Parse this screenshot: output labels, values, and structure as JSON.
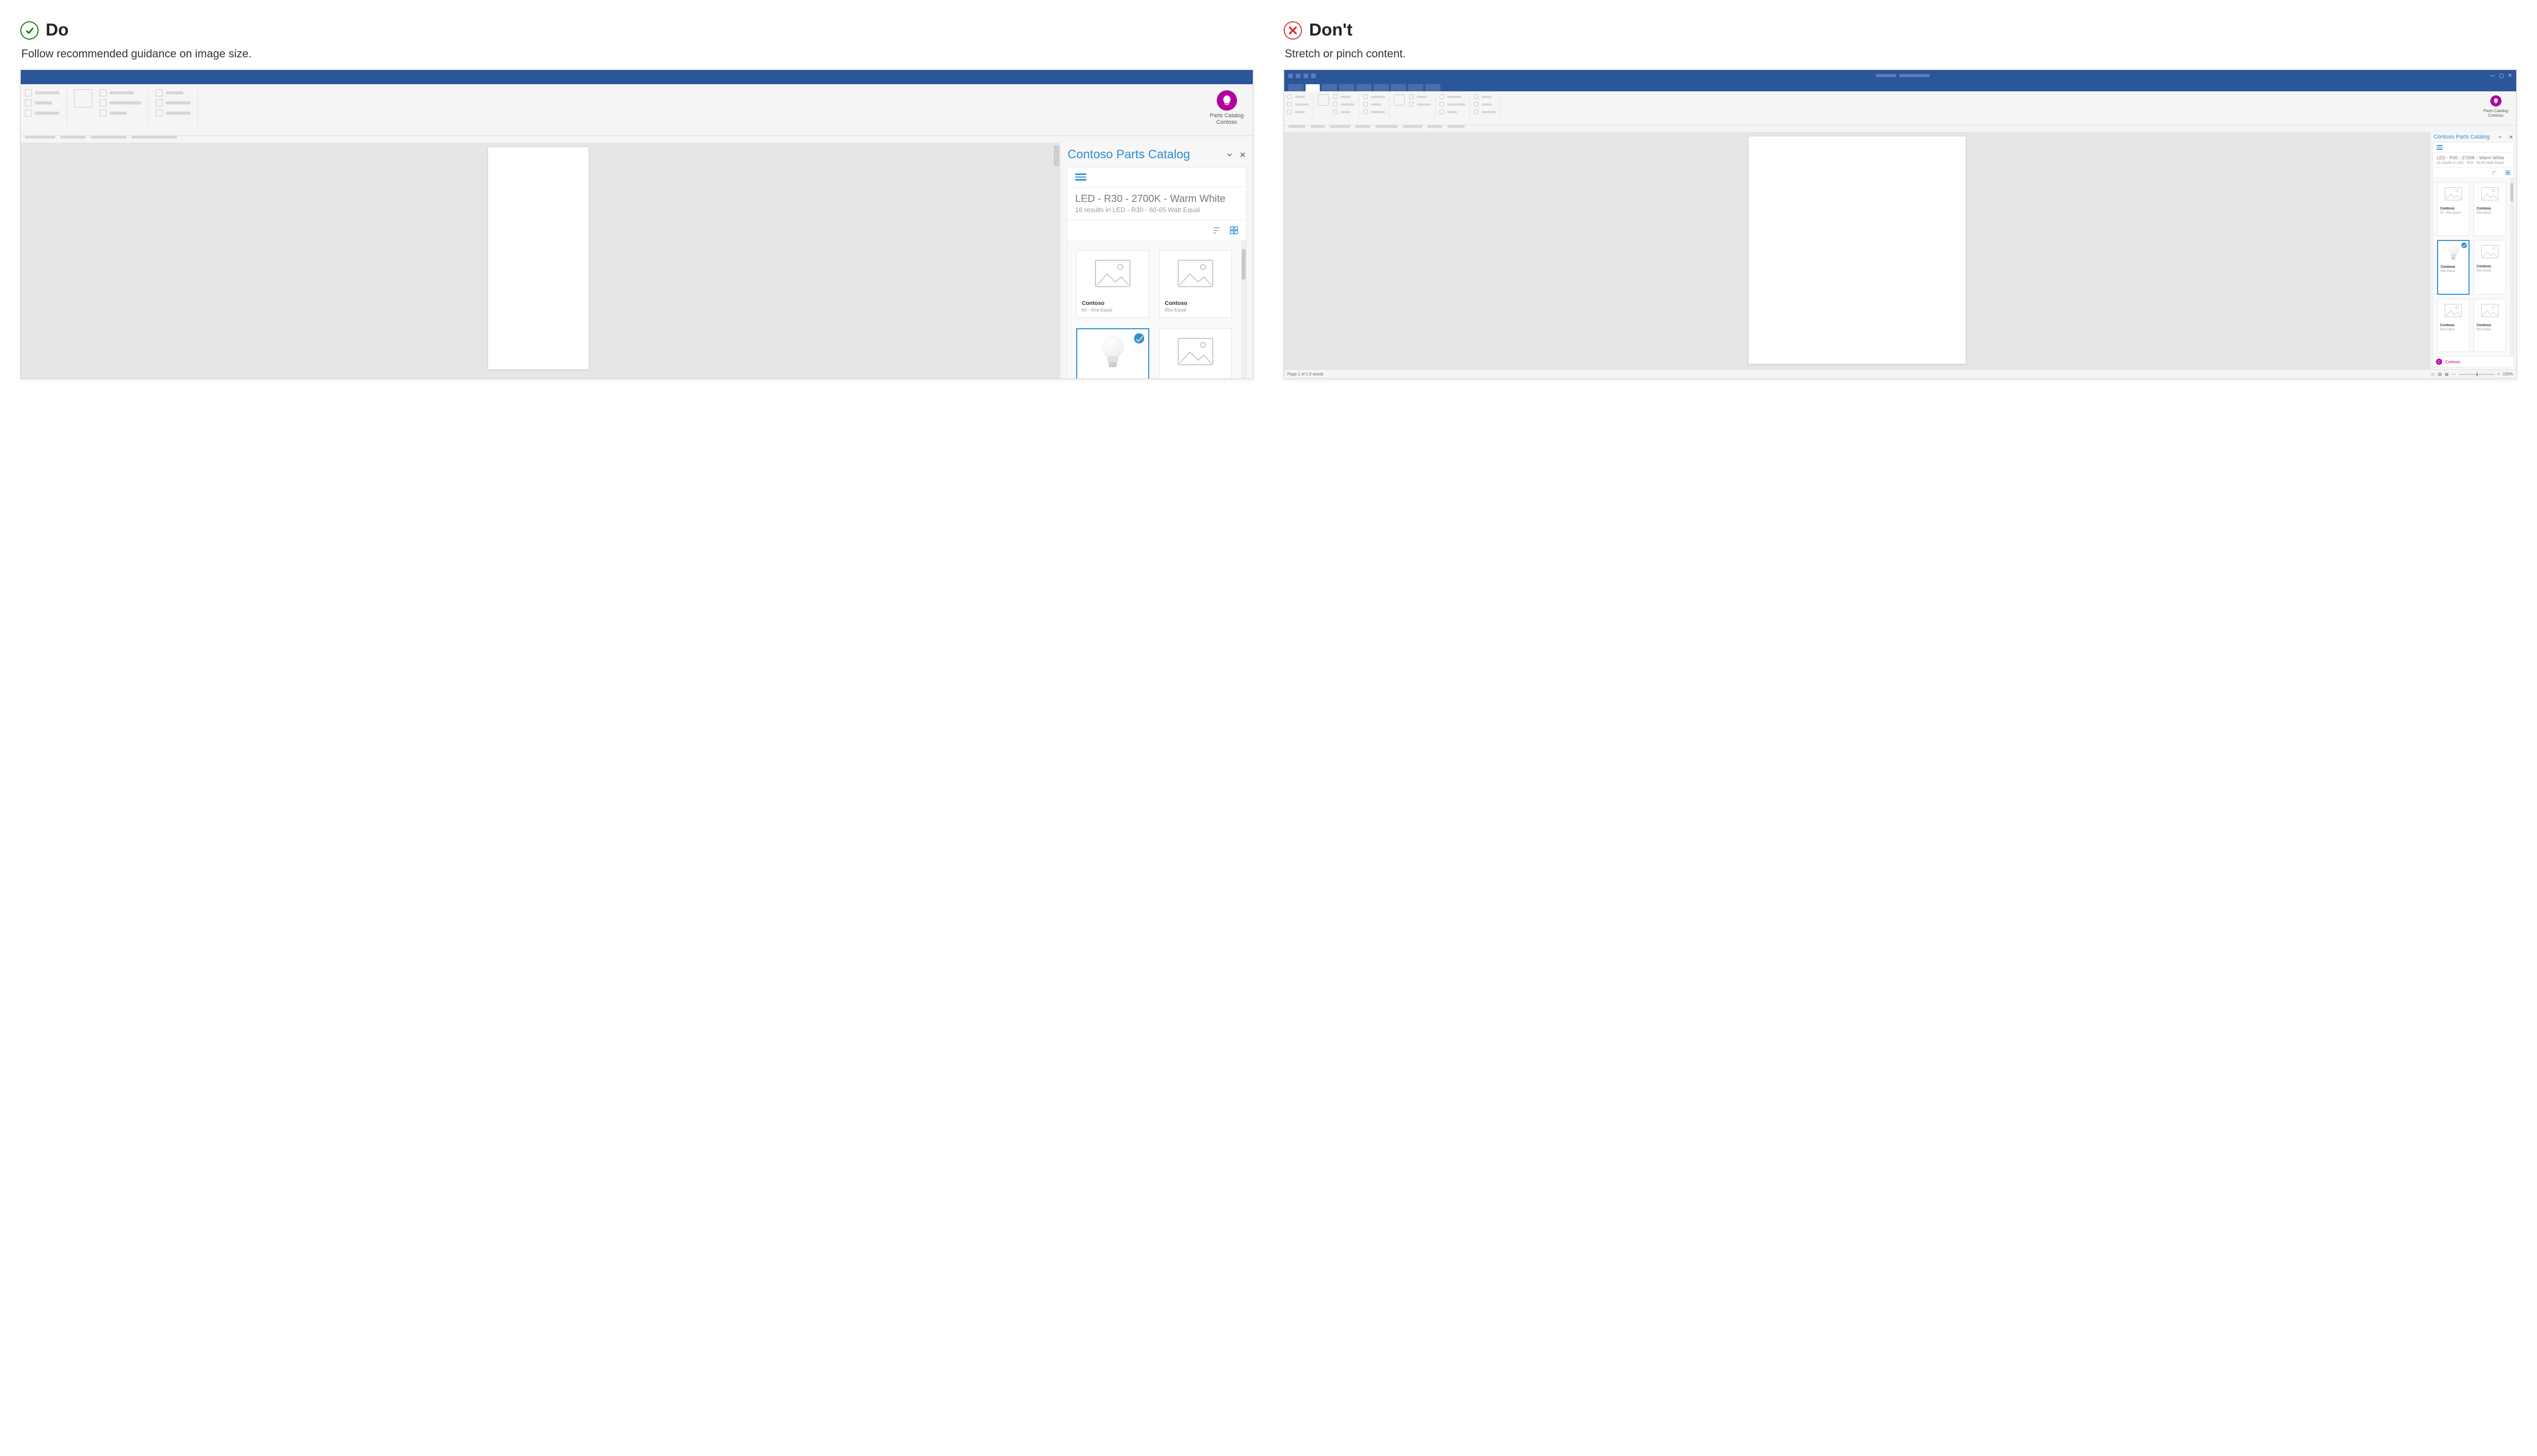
{
  "do": {
    "heading": "Do",
    "caption": "Follow recommended guidance on image size."
  },
  "dont": {
    "heading": "Don't",
    "caption": "Stretch or pinch content."
  },
  "addin": {
    "line1": "Parts Catalog",
    "line2": "Contoso"
  },
  "taskpane": {
    "title": "Contoso Parts Catalog",
    "breadcrumb": "LED - R30 - 2700K - Warm White",
    "subline": "16 results in LED - R30 - 60-65 Watt Equal",
    "cards": [
      {
        "brand": "Contoso",
        "desc": "60 - 65w Equal",
        "selected": false,
        "image": "placeholder"
      },
      {
        "brand": "Contoso",
        "desc": "85w Equal",
        "selected": false,
        "image": "placeholder"
      },
      {
        "brand": "Contoso",
        "desc": "65w Equal",
        "selected": true,
        "image": "bulb"
      },
      {
        "brand": "Contoso",
        "desc": "65w Equal",
        "selected": false,
        "image": "placeholder"
      },
      {
        "brand": "Contoso",
        "desc": "65w Equal",
        "selected": false,
        "image": "placeholder"
      },
      {
        "brand": "Contoso",
        "desc": "65w Equal",
        "selected": false,
        "image": "placeholder"
      }
    ],
    "footer_brand": "Contoso"
  },
  "statusbar": {
    "left": "Page 1 of 1    0 words",
    "zoom": "100%"
  }
}
